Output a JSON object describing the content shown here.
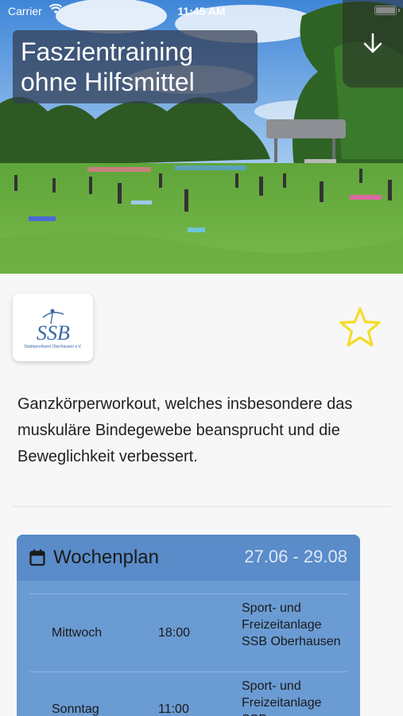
{
  "status_bar": {
    "carrier": "Carrier",
    "time": "11:45 AM"
  },
  "header": {
    "title_line1": "Faszientraining",
    "title_line2": "ohne Hilfsmittel"
  },
  "organizer": {
    "logo_text": "SSB",
    "logo_subtext": "Stadtsportbund Oberhausen e.V."
  },
  "description": "Ganzkörperworkout, welches insbesondere das muskuläre Bindegewebe beansprucht und die Beweglichkeit verbessert.",
  "schedule": {
    "title": "Wochenplan",
    "date_range": "27.06 - 29.08",
    "rows": [
      {
        "day": "Mittwoch",
        "time": "18:00",
        "place": "Sport- und Freizeitanlage SSB Oberhausen"
      },
      {
        "day": "Sonntag",
        "time": "11:00",
        "place": "Sport- und Freizeitanlage SSB"
      }
    ]
  },
  "colors": {
    "accent_blue": "#5a8cc9",
    "star_yellow": "#f5dc2a"
  },
  "icons": {
    "download": "arrow-down-icon",
    "favorite": "star-outline-icon",
    "calendar": "calendar-icon",
    "wifi": "wifi-icon",
    "battery": "battery-icon"
  }
}
